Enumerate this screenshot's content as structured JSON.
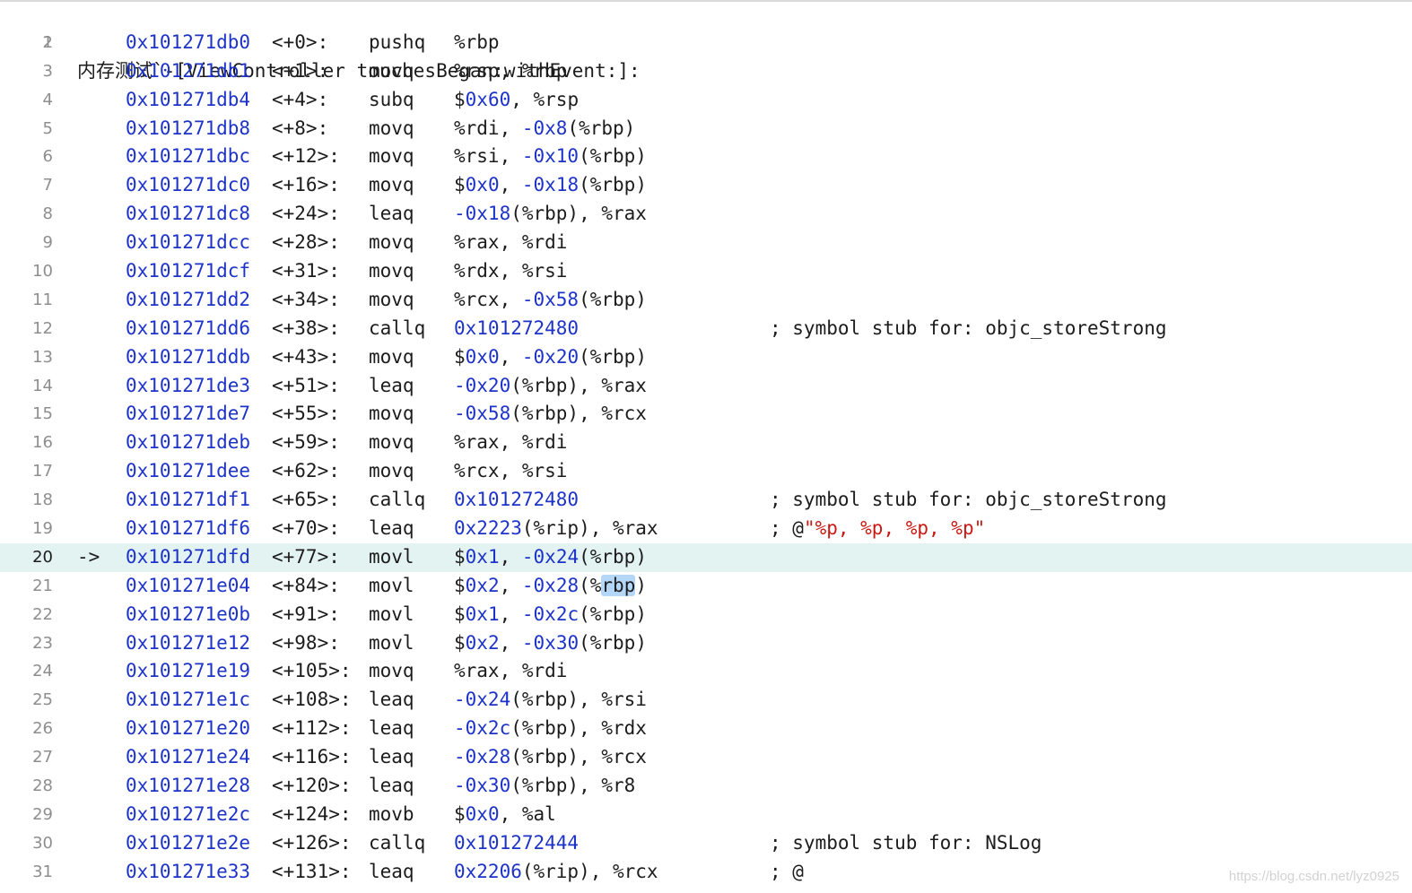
{
  "header": {
    "line_number": "1",
    "text": "内存测试`-[ViewController touchesBegan:withEvent:]:"
  },
  "current_arrow": "->",
  "lines": [
    {
      "n": "2",
      "addr": "0x101271db0",
      "offset": "<+0>:",
      "mnemonic": "pushq",
      "operands": [
        [
          "t",
          "%rbp"
        ]
      ]
    },
    {
      "n": "3",
      "addr": "0x101271db1",
      "offset": "<+1>:",
      "mnemonic": "movq",
      "operands": [
        [
          "t",
          "%rsp, %rbp"
        ]
      ]
    },
    {
      "n": "4",
      "addr": "0x101271db4",
      "offset": "<+4>:",
      "mnemonic": "subq",
      "operands": [
        [
          "t",
          "$"
        ],
        [
          "n",
          "0x60"
        ],
        [
          "t",
          ", %rsp"
        ]
      ]
    },
    {
      "n": "5",
      "addr": "0x101271db8",
      "offset": "<+8>:",
      "mnemonic": "movq",
      "operands": [
        [
          "t",
          "%rdi, "
        ],
        [
          "n",
          "-0x8"
        ],
        [
          "t",
          "(%rbp)"
        ]
      ]
    },
    {
      "n": "6",
      "addr": "0x101271dbc",
      "offset": "<+12>:",
      "mnemonic": "movq",
      "operands": [
        [
          "t",
          "%rsi, "
        ],
        [
          "n",
          "-0x10"
        ],
        [
          "t",
          "(%rbp)"
        ]
      ]
    },
    {
      "n": "7",
      "addr": "0x101271dc0",
      "offset": "<+16>:",
      "mnemonic": "movq",
      "operands": [
        [
          "t",
          "$"
        ],
        [
          "n",
          "0x0"
        ],
        [
          "t",
          ", "
        ],
        [
          "n",
          "-0x18"
        ],
        [
          "t",
          "(%rbp)"
        ]
      ]
    },
    {
      "n": "8",
      "addr": "0x101271dc8",
      "offset": "<+24>:",
      "mnemonic": "leaq",
      "operands": [
        [
          "n",
          "-0x18"
        ],
        [
          "t",
          "(%rbp), %rax"
        ]
      ]
    },
    {
      "n": "9",
      "addr": "0x101271dcc",
      "offset": "<+28>:",
      "mnemonic": "movq",
      "operands": [
        [
          "t",
          "%rax, %rdi"
        ]
      ]
    },
    {
      "n": "10",
      "addr": "0x101271dcf",
      "offset": "<+31>:",
      "mnemonic": "movq",
      "operands": [
        [
          "t",
          "%rdx, %rsi"
        ]
      ]
    },
    {
      "n": "11",
      "addr": "0x101271dd2",
      "offset": "<+34>:",
      "mnemonic": "movq",
      "operands": [
        [
          "t",
          "%rcx, "
        ],
        [
          "n",
          "-0x58"
        ],
        [
          "t",
          "(%rbp)"
        ]
      ]
    },
    {
      "n": "12",
      "addr": "0x101271dd6",
      "offset": "<+38>:",
      "mnemonic": "callq",
      "operands": [
        [
          "n",
          "0x101272480"
        ]
      ],
      "comment": [
        [
          "t",
          "; symbol stub for: objc_storeStrong"
        ]
      ]
    },
    {
      "n": "13",
      "addr": "0x101271ddb",
      "offset": "<+43>:",
      "mnemonic": "movq",
      "operands": [
        [
          "t",
          "$"
        ],
        [
          "n",
          "0x0"
        ],
        [
          "t",
          ", "
        ],
        [
          "n",
          "-0x20"
        ],
        [
          "t",
          "(%rbp)"
        ]
      ]
    },
    {
      "n": "14",
      "addr": "0x101271de3",
      "offset": "<+51>:",
      "mnemonic": "leaq",
      "operands": [
        [
          "n",
          "-0x20"
        ],
        [
          "t",
          "(%rbp), %rax"
        ]
      ]
    },
    {
      "n": "15",
      "addr": "0x101271de7",
      "offset": "<+55>:",
      "mnemonic": "movq",
      "operands": [
        [
          "n",
          "-0x58"
        ],
        [
          "t",
          "(%rbp), %rcx"
        ]
      ]
    },
    {
      "n": "16",
      "addr": "0x101271deb",
      "offset": "<+59>:",
      "mnemonic": "movq",
      "operands": [
        [
          "t",
          "%rax, %rdi"
        ]
      ]
    },
    {
      "n": "17",
      "addr": "0x101271dee",
      "offset": "<+62>:",
      "mnemonic": "movq",
      "operands": [
        [
          "t",
          "%rcx, %rsi"
        ]
      ]
    },
    {
      "n": "18",
      "addr": "0x101271df1",
      "offset": "<+65>:",
      "mnemonic": "callq",
      "operands": [
        [
          "n",
          "0x101272480"
        ]
      ],
      "comment": [
        [
          "t",
          "; symbol stub for: objc_storeStrong"
        ]
      ]
    },
    {
      "n": "19",
      "addr": "0x101271df6",
      "offset": "<+70>:",
      "mnemonic": "leaq",
      "operands": [
        [
          "n",
          "0x2223"
        ],
        [
          "t",
          "(%rip), %rax"
        ]
      ],
      "comment": [
        [
          "t",
          "; @"
        ],
        [
          "s",
          "\"%p, %p, %p, %p\""
        ]
      ]
    },
    {
      "n": "20",
      "addr": "0x101271dfd",
      "offset": "<+77>:",
      "mnemonic": "movl",
      "operands": [
        [
          "t",
          "$"
        ],
        [
          "n",
          "0x1"
        ],
        [
          "t",
          ", "
        ],
        [
          "n",
          "-0x24"
        ],
        [
          "t",
          "(%rbp)"
        ]
      ],
      "current": true
    },
    {
      "n": "21",
      "addr": "0x101271e04",
      "offset": "<+84>:",
      "mnemonic": "movl",
      "operands": [
        [
          "t",
          "$"
        ],
        [
          "n",
          "0x2"
        ],
        [
          "t",
          ", "
        ],
        [
          "n",
          "-0x28"
        ],
        [
          "t",
          "(%"
        ],
        [
          "h",
          "rbp"
        ],
        [
          "t",
          ")"
        ]
      ]
    },
    {
      "n": "22",
      "addr": "0x101271e0b",
      "offset": "<+91>:",
      "mnemonic": "movl",
      "operands": [
        [
          "t",
          "$"
        ],
        [
          "n",
          "0x1"
        ],
        [
          "t",
          ", "
        ],
        [
          "n",
          "-0x2c"
        ],
        [
          "t",
          "(%rbp)"
        ]
      ]
    },
    {
      "n": "23",
      "addr": "0x101271e12",
      "offset": "<+98>:",
      "mnemonic": "movl",
      "operands": [
        [
          "t",
          "$"
        ],
        [
          "n",
          "0x2"
        ],
        [
          "t",
          ", "
        ],
        [
          "n",
          "-0x30"
        ],
        [
          "t",
          "(%rbp)"
        ]
      ]
    },
    {
      "n": "24",
      "addr": "0x101271e19",
      "offset": "<+105>:",
      "mnemonic": "movq",
      "operands": [
        [
          "t",
          "%rax, %rdi"
        ]
      ]
    },
    {
      "n": "25",
      "addr": "0x101271e1c",
      "offset": "<+108>:",
      "mnemonic": "leaq",
      "operands": [
        [
          "n",
          "-0x24"
        ],
        [
          "t",
          "(%rbp), %rsi"
        ]
      ]
    },
    {
      "n": "26",
      "addr": "0x101271e20",
      "offset": "<+112>:",
      "mnemonic": "leaq",
      "operands": [
        [
          "n",
          "-0x2c"
        ],
        [
          "t",
          "(%rbp), %rdx"
        ]
      ]
    },
    {
      "n": "27",
      "addr": "0x101271e24",
      "offset": "<+116>:",
      "mnemonic": "leaq",
      "operands": [
        [
          "n",
          "-0x28"
        ],
        [
          "t",
          "(%rbp), %rcx"
        ]
      ]
    },
    {
      "n": "28",
      "addr": "0x101271e28",
      "offset": "<+120>:",
      "mnemonic": "leaq",
      "operands": [
        [
          "n",
          "-0x30"
        ],
        [
          "t",
          "(%rbp), %r8"
        ]
      ]
    },
    {
      "n": "29",
      "addr": "0x101271e2c",
      "offset": "<+124>:",
      "mnemonic": "movb",
      "operands": [
        [
          "t",
          "$"
        ],
        [
          "n",
          "0x0"
        ],
        [
          "t",
          ", %al"
        ]
      ]
    },
    {
      "n": "30",
      "addr": "0x101271e2e",
      "offset": "<+126>:",
      "mnemonic": "callq",
      "operands": [
        [
          "n",
          "0x101272444"
        ]
      ],
      "comment": [
        [
          "t",
          "; symbol stub for: NSLog"
        ]
      ]
    },
    {
      "n": "31",
      "addr": "0x101271e33",
      "offset": "<+131>:",
      "mnemonic": "leaq",
      "operands": [
        [
          "n",
          "0x2206"
        ],
        [
          "t",
          "(%rip), %rcx"
        ]
      ],
      "comment": [
        [
          "t",
          "; @"
        ]
      ]
    }
  ],
  "watermark": "https://blog.csdn.net/lyz0925",
  "colors": {
    "address": "#1d33c8",
    "number": "#1d33c8",
    "string": "#c81a13",
    "current_line_bg": "#e3f3f2",
    "selection": "#b4d7f8"
  }
}
